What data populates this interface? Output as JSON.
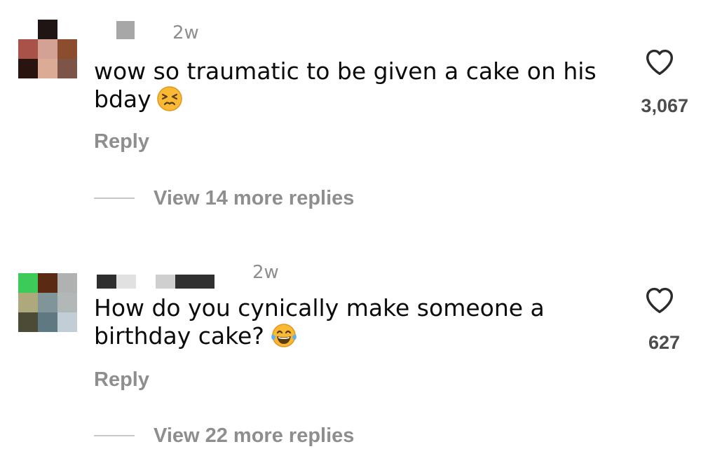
{
  "comments": [
    {
      "time": "2w",
      "text": "wow so traumatic to be given a cake on his bday",
      "emoji": "persevering-face-emoji",
      "reply_label": "Reply",
      "like_count": "3,067",
      "view_replies_label": "View 14 more replies",
      "avatar_pixels": [
        "#ffffff",
        "#1e1514",
        "#ffffff",
        "#a9524a",
        "#d4a195",
        "#8a4e2f",
        "#2a1410",
        "#dcab96",
        "#7d5548"
      ],
      "username_blocks": [
        "#a7a7a7"
      ]
    },
    {
      "time": "2w",
      "text": "How do you cynically make someone a birthday cake?",
      "emoji": "tears-of-joy-emoji",
      "reply_label": "Reply",
      "like_count": "627",
      "view_replies_label": "View 22 more replies",
      "avatar_pixels": [
        "#3ccb59",
        "#5a2a12",
        "#b0b2b1",
        "#aea97d",
        "#7f959a",
        "#b2b7b8",
        "#4c4c36",
        "#5f7982",
        "#c1ced5"
      ],
      "username_blocks": [
        "#2e2e2e",
        "#e1e1e1",
        "#cfcfcf",
        "#303030"
      ]
    }
  ],
  "colors": {
    "secondary_text": "#8e8e8e",
    "primary_text": "#0b0b0b",
    "like_count": "#4d4d4d"
  },
  "icons": {
    "like": "heart-outline-icon"
  }
}
